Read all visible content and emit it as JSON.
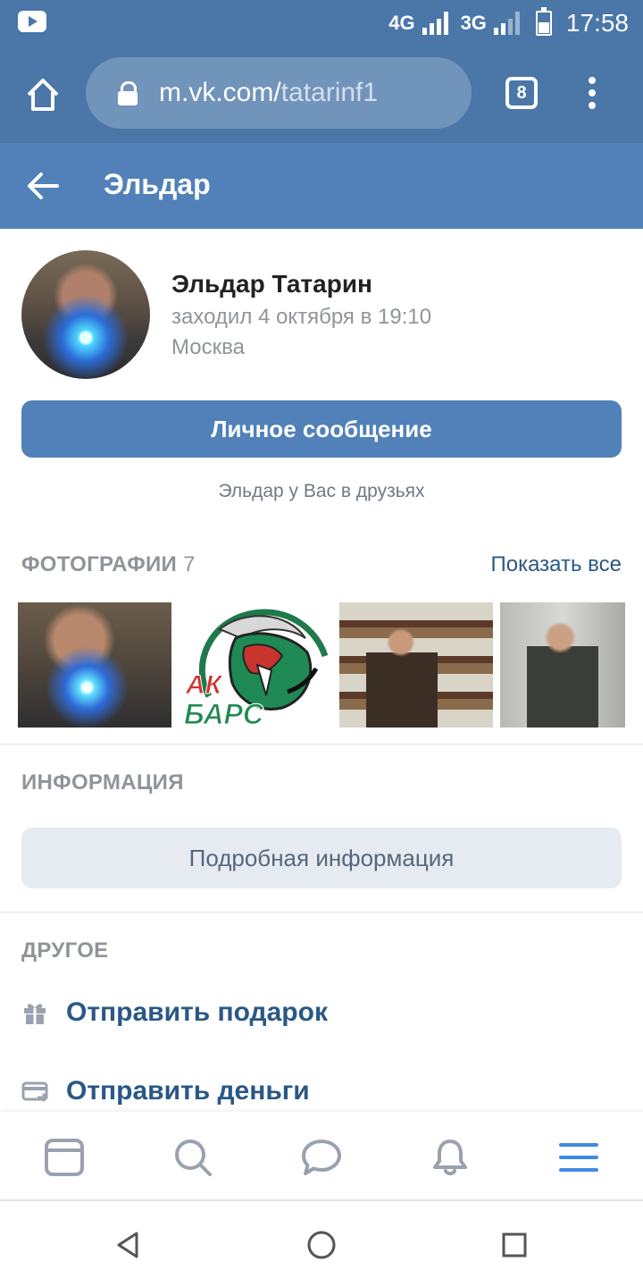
{
  "status_bar": {
    "network_1": "4G",
    "network_2": "3G",
    "time": "17:58"
  },
  "browser": {
    "url_host": "m.vk.com/",
    "url_path": "tatarinf1",
    "tab_count": "8"
  },
  "header": {
    "title": "Эльдар"
  },
  "profile": {
    "name": "Эльдар Татарин",
    "last_seen": "заходил 4 октября в 19:10",
    "city": "Москва",
    "message_button": "Личное сообщение",
    "friend_note": "Эльдар у Вас в друзьях"
  },
  "photos": {
    "title": "ФОТОГРАФИИ",
    "count": "7",
    "show_all": "Показать все",
    "logo_text_1": "АК",
    "logo_text_2": "БАРС"
  },
  "info": {
    "title": "ИНФОРМАЦИЯ",
    "details_button": "Подробная информация"
  },
  "other": {
    "title": "ДРУГОЕ",
    "actions": [
      {
        "label": "Отправить подарок",
        "icon": "gift-icon"
      },
      {
        "label": "Отправить деньги",
        "icon": "money-transfer-icon"
      }
    ]
  },
  "tabbar": {
    "items": [
      "news-icon",
      "search-icon",
      "messages-icon",
      "notifications-icon",
      "menu-icon"
    ],
    "active": "menu-icon"
  },
  "colors": {
    "vk_blue": "#5181b8",
    "browser_blue": "#4a76a8",
    "link_blue": "#2a5885",
    "muted": "#909499",
    "accent": "#3f8ae0"
  }
}
